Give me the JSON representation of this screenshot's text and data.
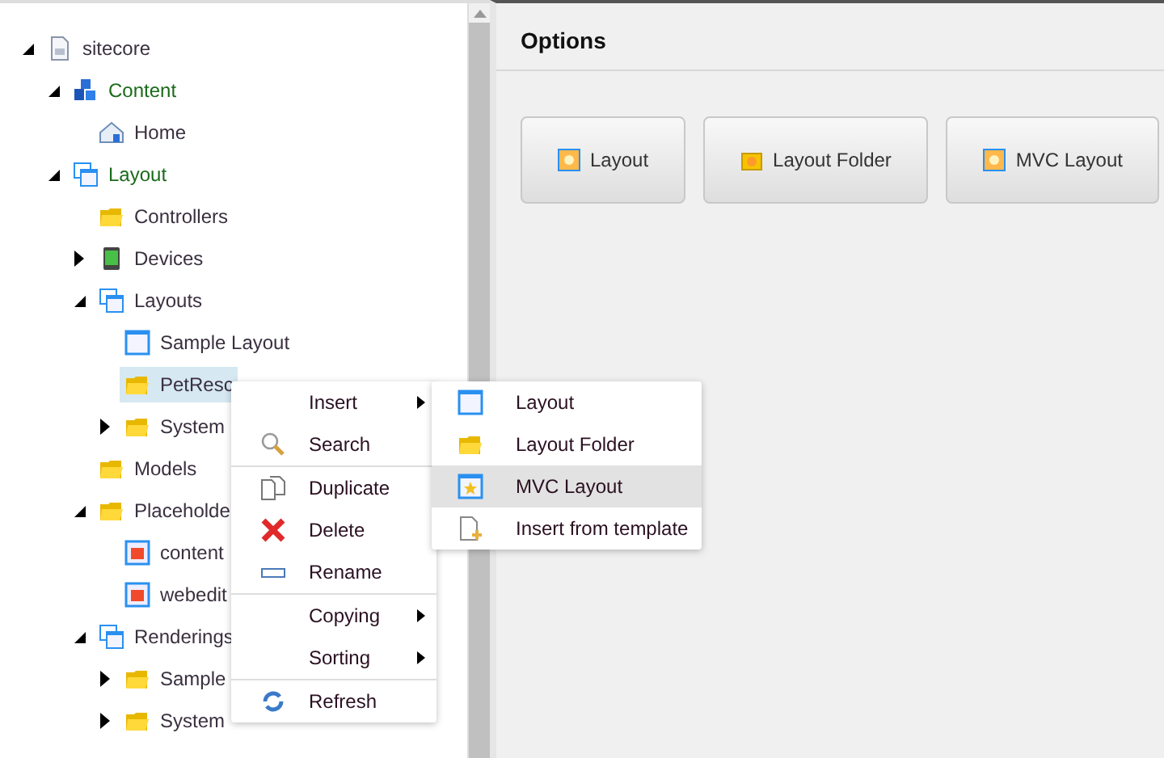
{
  "tree": [
    {
      "label": "sitecore",
      "kind": "document",
      "expanded": true,
      "emphasis": false,
      "selected": false,
      "children": [
        {
          "label": "Content",
          "kind": "cubes",
          "expanded": true,
          "emphasis": true,
          "selected": false,
          "children": [
            {
              "label": "Home",
              "kind": "home",
              "emphasis": false,
              "selected": false
            }
          ]
        },
        {
          "label": "Layout",
          "kind": "windows",
          "expanded": true,
          "emphasis": true,
          "selected": false,
          "children": [
            {
              "label": "Controllers",
              "kind": "folder",
              "emphasis": false,
              "selected": false
            },
            {
              "label": "Devices",
              "kind": "device",
              "expanded": false,
              "emphasis": false,
              "selected": false
            },
            {
              "label": "Layouts",
              "kind": "windows",
              "expanded": true,
              "emphasis": false,
              "selected": false,
              "children": [
                {
                  "label": "Sample Layout",
                  "kind": "window",
                  "emphasis": false,
                  "selected": false
                },
                {
                  "label": "PetResc",
                  "kind": "folder",
                  "emphasis": false,
                  "selected": true
                },
                {
                  "label": "System",
                  "kind": "folder",
                  "expanded": false,
                  "emphasis": false,
                  "selected": false
                }
              ]
            },
            {
              "label": "Models",
              "kind": "folder",
              "emphasis": false,
              "selected": false
            },
            {
              "label": "Placeholde",
              "kind": "folder",
              "expanded": true,
              "emphasis": false,
              "selected": false,
              "children": [
                {
                  "label": "content",
                  "kind": "placeholder",
                  "emphasis": false,
                  "selected": false
                },
                {
                  "label": "webedit",
                  "kind": "placeholder",
                  "emphasis": false,
                  "selected": false
                }
              ]
            },
            {
              "label": "Renderings",
              "kind": "renderings",
              "expanded": true,
              "emphasis": false,
              "selected": false,
              "children": [
                {
                  "label": "Sample",
                  "kind": "folder",
                  "expanded": false,
                  "emphasis": false,
                  "selected": false
                },
                {
                  "label": "System",
                  "kind": "folder",
                  "expanded": false,
                  "emphasis": false,
                  "selected": false
                }
              ]
            }
          ]
        }
      ]
    }
  ],
  "options": {
    "title": "Options",
    "buttons": [
      {
        "label": "Layout",
        "kind": "window"
      },
      {
        "label": "Layout Folder",
        "kind": "folder"
      },
      {
        "label": "MVC Layout",
        "kind": "window"
      }
    ]
  },
  "context_menu": {
    "groups": [
      [
        {
          "label": "Insert",
          "kind": "none",
          "submenu": true
        },
        {
          "label": "Search",
          "kind": "search",
          "submenu": false
        }
      ],
      [
        {
          "label": "Duplicate",
          "kind": "duplicate",
          "submenu": false
        },
        {
          "label": "Delete",
          "kind": "delete",
          "submenu": false
        },
        {
          "label": "Rename",
          "kind": "rename",
          "submenu": false
        }
      ],
      [
        {
          "label": "Copying",
          "kind": "none",
          "submenu": true
        },
        {
          "label": "Sorting",
          "kind": "none",
          "submenu": true
        }
      ],
      [
        {
          "label": "Refresh",
          "kind": "refresh",
          "submenu": false
        }
      ]
    ]
  },
  "submenu": {
    "items": [
      {
        "label": "Layout",
        "kind": "window",
        "selected": false
      },
      {
        "label": "Layout Folder",
        "kind": "folder",
        "selected": false
      },
      {
        "label": "MVC Layout",
        "kind": "star-window",
        "selected": true
      },
      {
        "label": "Insert from template",
        "kind": "new-document",
        "selected": false
      }
    ]
  }
}
